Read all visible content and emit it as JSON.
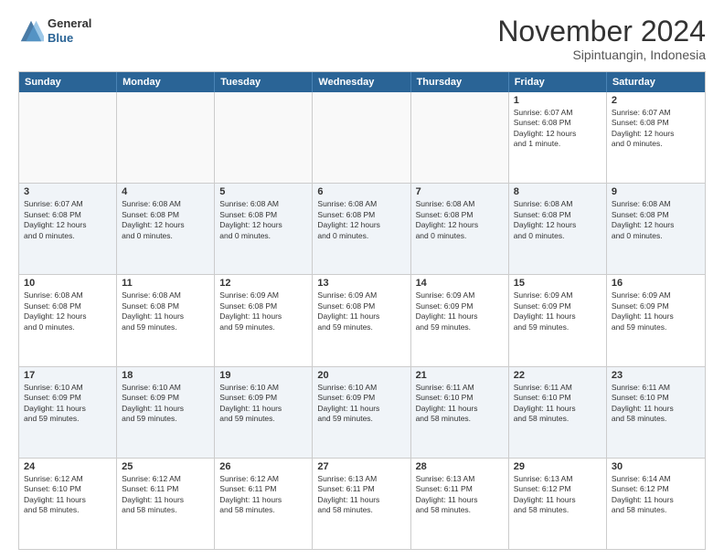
{
  "header": {
    "logo_line1": "General",
    "logo_line2": "Blue",
    "month_title": "November 2024",
    "location": "Sipintuangin, Indonesia"
  },
  "days_of_week": [
    "Sunday",
    "Monday",
    "Tuesday",
    "Wednesday",
    "Thursday",
    "Friday",
    "Saturday"
  ],
  "weeks": [
    [
      {
        "day": "",
        "empty": true,
        "text": ""
      },
      {
        "day": "",
        "empty": true,
        "text": ""
      },
      {
        "day": "",
        "empty": true,
        "text": ""
      },
      {
        "day": "",
        "empty": true,
        "text": ""
      },
      {
        "day": "",
        "empty": true,
        "text": ""
      },
      {
        "day": "1",
        "empty": false,
        "text": "Sunrise: 6:07 AM\nSunset: 6:08 PM\nDaylight: 12 hours\nand 1 minute."
      },
      {
        "day": "2",
        "empty": false,
        "text": "Sunrise: 6:07 AM\nSunset: 6:08 PM\nDaylight: 12 hours\nand 0 minutes."
      }
    ],
    [
      {
        "day": "3",
        "empty": false,
        "text": "Sunrise: 6:07 AM\nSunset: 6:08 PM\nDaylight: 12 hours\nand 0 minutes."
      },
      {
        "day": "4",
        "empty": false,
        "text": "Sunrise: 6:08 AM\nSunset: 6:08 PM\nDaylight: 12 hours\nand 0 minutes."
      },
      {
        "day": "5",
        "empty": false,
        "text": "Sunrise: 6:08 AM\nSunset: 6:08 PM\nDaylight: 12 hours\nand 0 minutes."
      },
      {
        "day": "6",
        "empty": false,
        "text": "Sunrise: 6:08 AM\nSunset: 6:08 PM\nDaylight: 12 hours\nand 0 minutes."
      },
      {
        "day": "7",
        "empty": false,
        "text": "Sunrise: 6:08 AM\nSunset: 6:08 PM\nDaylight: 12 hours\nand 0 minutes."
      },
      {
        "day": "8",
        "empty": false,
        "text": "Sunrise: 6:08 AM\nSunset: 6:08 PM\nDaylight: 12 hours\nand 0 minutes."
      },
      {
        "day": "9",
        "empty": false,
        "text": "Sunrise: 6:08 AM\nSunset: 6:08 PM\nDaylight: 12 hours\nand 0 minutes."
      }
    ],
    [
      {
        "day": "10",
        "empty": false,
        "text": "Sunrise: 6:08 AM\nSunset: 6:08 PM\nDaylight: 12 hours\nand 0 minutes."
      },
      {
        "day": "11",
        "empty": false,
        "text": "Sunrise: 6:08 AM\nSunset: 6:08 PM\nDaylight: 11 hours\nand 59 minutes."
      },
      {
        "day": "12",
        "empty": false,
        "text": "Sunrise: 6:09 AM\nSunset: 6:08 PM\nDaylight: 11 hours\nand 59 minutes."
      },
      {
        "day": "13",
        "empty": false,
        "text": "Sunrise: 6:09 AM\nSunset: 6:08 PM\nDaylight: 11 hours\nand 59 minutes."
      },
      {
        "day": "14",
        "empty": false,
        "text": "Sunrise: 6:09 AM\nSunset: 6:09 PM\nDaylight: 11 hours\nand 59 minutes."
      },
      {
        "day": "15",
        "empty": false,
        "text": "Sunrise: 6:09 AM\nSunset: 6:09 PM\nDaylight: 11 hours\nand 59 minutes."
      },
      {
        "day": "16",
        "empty": false,
        "text": "Sunrise: 6:09 AM\nSunset: 6:09 PM\nDaylight: 11 hours\nand 59 minutes."
      }
    ],
    [
      {
        "day": "17",
        "empty": false,
        "text": "Sunrise: 6:10 AM\nSunset: 6:09 PM\nDaylight: 11 hours\nand 59 minutes."
      },
      {
        "day": "18",
        "empty": false,
        "text": "Sunrise: 6:10 AM\nSunset: 6:09 PM\nDaylight: 11 hours\nand 59 minutes."
      },
      {
        "day": "19",
        "empty": false,
        "text": "Sunrise: 6:10 AM\nSunset: 6:09 PM\nDaylight: 11 hours\nand 59 minutes."
      },
      {
        "day": "20",
        "empty": false,
        "text": "Sunrise: 6:10 AM\nSunset: 6:09 PM\nDaylight: 11 hours\nand 59 minutes."
      },
      {
        "day": "21",
        "empty": false,
        "text": "Sunrise: 6:11 AM\nSunset: 6:10 PM\nDaylight: 11 hours\nand 58 minutes."
      },
      {
        "day": "22",
        "empty": false,
        "text": "Sunrise: 6:11 AM\nSunset: 6:10 PM\nDaylight: 11 hours\nand 58 minutes."
      },
      {
        "day": "23",
        "empty": false,
        "text": "Sunrise: 6:11 AM\nSunset: 6:10 PM\nDaylight: 11 hours\nand 58 minutes."
      }
    ],
    [
      {
        "day": "24",
        "empty": false,
        "text": "Sunrise: 6:12 AM\nSunset: 6:10 PM\nDaylight: 11 hours\nand 58 minutes."
      },
      {
        "day": "25",
        "empty": false,
        "text": "Sunrise: 6:12 AM\nSunset: 6:11 PM\nDaylight: 11 hours\nand 58 minutes."
      },
      {
        "day": "26",
        "empty": false,
        "text": "Sunrise: 6:12 AM\nSunset: 6:11 PM\nDaylight: 11 hours\nand 58 minutes."
      },
      {
        "day": "27",
        "empty": false,
        "text": "Sunrise: 6:13 AM\nSunset: 6:11 PM\nDaylight: 11 hours\nand 58 minutes."
      },
      {
        "day": "28",
        "empty": false,
        "text": "Sunrise: 6:13 AM\nSunset: 6:11 PM\nDaylight: 11 hours\nand 58 minutes."
      },
      {
        "day": "29",
        "empty": false,
        "text": "Sunrise: 6:13 AM\nSunset: 6:12 PM\nDaylight: 11 hours\nand 58 minutes."
      },
      {
        "day": "30",
        "empty": false,
        "text": "Sunrise: 6:14 AM\nSunset: 6:12 PM\nDaylight: 11 hours\nand 58 minutes."
      }
    ]
  ]
}
